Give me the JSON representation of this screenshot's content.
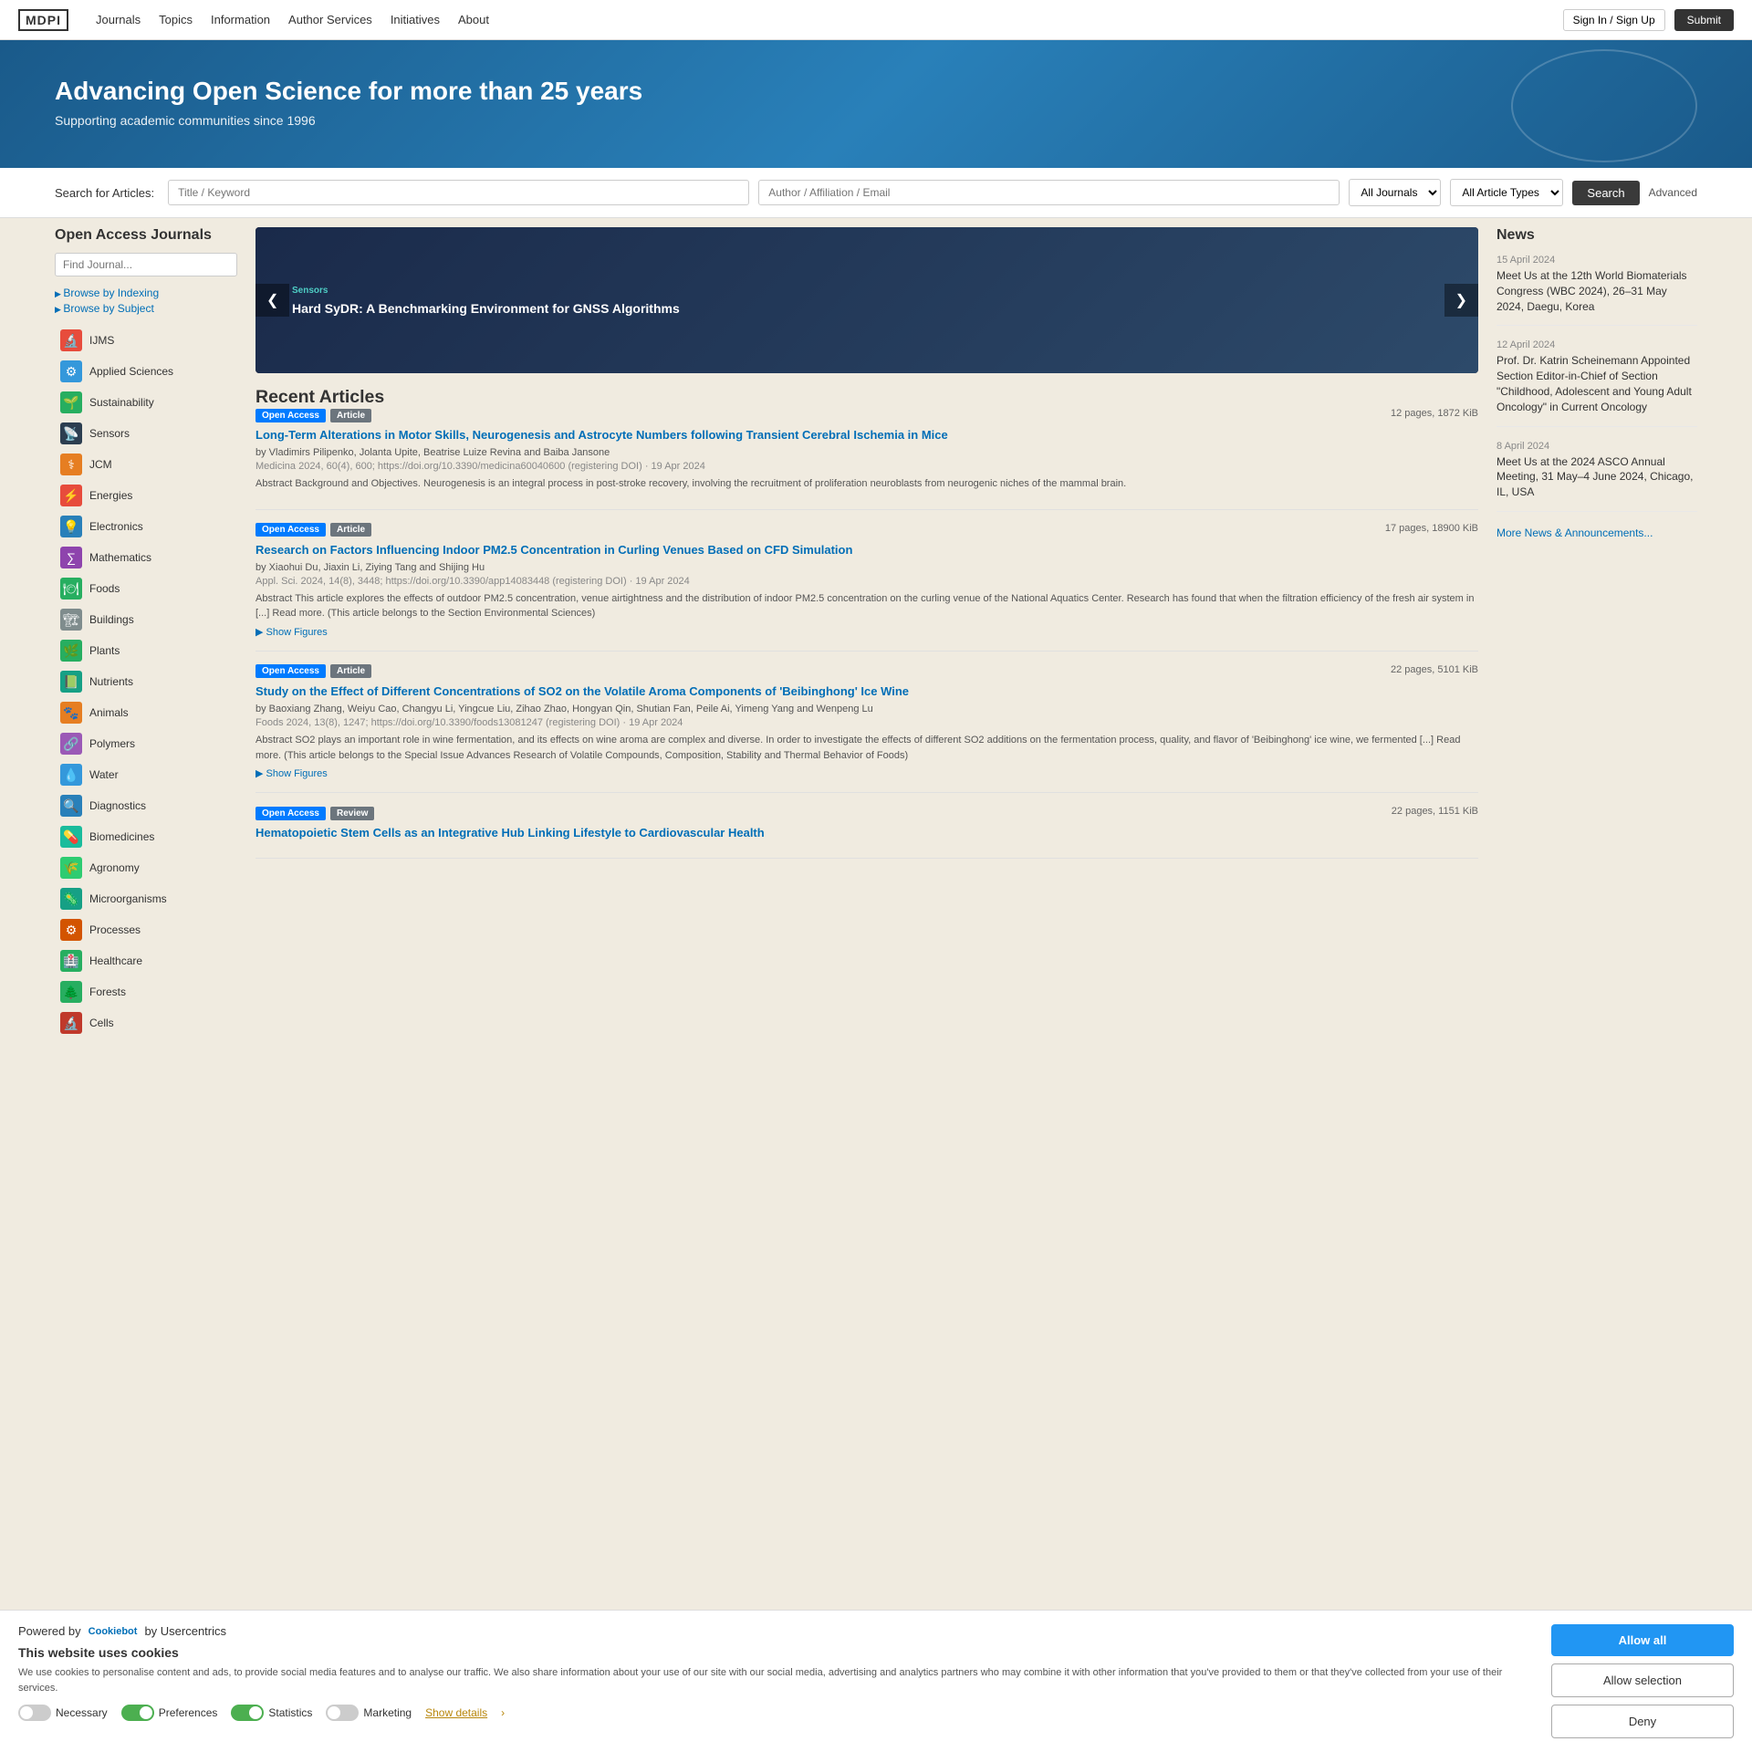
{
  "nav": {
    "logo": "MDPI",
    "links": [
      "Journals",
      "Topics",
      "Information",
      "Author Services",
      "Initiatives",
      "About"
    ],
    "signin": "Sign In / Sign Up",
    "submit": "Submit"
  },
  "hero": {
    "title": "Advancing Open Science for more than 25 years",
    "subtitle": "Supporting academic communities since 1996"
  },
  "search": {
    "label": "Search for Articles:",
    "title_placeholder": "Title / Keyword",
    "author_placeholder": "Author / Affiliation / Email",
    "journals_default": "All Journals",
    "types_default": "All Article Types",
    "search_btn": "Search",
    "advanced_btn": "Advanced"
  },
  "sidebar": {
    "title": "Open Access Journals",
    "find_journal_placeholder": "Find Journal...",
    "browse_by_indexing": "Browse by Indexing",
    "browse_by_subject": "Browse by Subject",
    "subjects": [
      {
        "label": "IJMS",
        "color": "#e74c3c",
        "icon": "🔬"
      },
      {
        "label": "Applied Sciences",
        "color": "#3498db",
        "icon": "⚙"
      },
      {
        "label": "Sustainability",
        "color": "#27ae60",
        "icon": "🌱"
      },
      {
        "label": "Sensors",
        "color": "#2c3e50",
        "icon": "📡"
      },
      {
        "label": "JCM",
        "color": "#e67e22",
        "icon": "⚕"
      },
      {
        "label": "Energies",
        "color": "#e74c3c",
        "icon": "⚡"
      },
      {
        "label": "Electronics",
        "color": "#2980b9",
        "icon": "💡"
      },
      {
        "label": "Mathematics",
        "color": "#8e44ad",
        "icon": "∑"
      },
      {
        "label": "Foods",
        "color": "#27ae60",
        "icon": "🍽"
      },
      {
        "label": "Buildings",
        "color": "#7f8c8d",
        "icon": "🏗"
      },
      {
        "label": "Plants",
        "color": "#27ae60",
        "icon": "🌿"
      },
      {
        "label": "Nutrients",
        "color": "#16a085",
        "icon": "📗"
      },
      {
        "label": "Animals",
        "color": "#e67e22",
        "icon": "🐾"
      },
      {
        "label": "Polymers",
        "color": "#9b59b6",
        "icon": "🔗"
      },
      {
        "label": "Water",
        "color": "#3498db",
        "icon": "💧"
      },
      {
        "label": "Diagnostics",
        "color": "#2980b9",
        "icon": "🔍"
      },
      {
        "label": "Biomedicines",
        "color": "#1abc9c",
        "icon": "💊"
      },
      {
        "label": "Agronomy",
        "color": "#2ecc71",
        "icon": "🌾"
      },
      {
        "label": "Microorganisms",
        "color": "#16a085",
        "icon": "🦠"
      },
      {
        "label": "Processes",
        "color": "#d35400",
        "icon": "⚙"
      },
      {
        "label": "Healthcare",
        "color": "#27ae60",
        "icon": "🏥"
      },
      {
        "label": "Forests",
        "color": "#27ae60",
        "icon": "🌲"
      },
      {
        "label": "Cells",
        "color": "#c0392b",
        "icon": "🔬"
      }
    ]
  },
  "carousel": {
    "journal": "Sensors",
    "title": "Hard SyDR: A Benchmarking Environment for GNSS Algorithms",
    "left_arrow": "❮",
    "right_arrow": "❯"
  },
  "recent_articles": {
    "heading": "Recent Articles",
    "articles": [
      {
        "badge_oa": "Open Access",
        "badge_type": "Article",
        "pages": "12 pages, 1872 KiB",
        "title": "Long-Term Alterations in Motor Skills, Neurogenesis and Astrocyte Numbers following Transient Cerebral Ischemia in Mice",
        "authors": "by Vladimirs Pilipenko, Jolanta Upite, Beatrise Luize Revina and Baiba Jansone",
        "journal": "Medicina 2024, 60(4), 600; https://doi.org/10.3390/medicina60040600 (registering DOI) · 19 Apr 2024",
        "abstract": "Abstract Background and Objectives. Neurogenesis is an integral process in post-stroke recovery, involving the recruitment of proliferation neuroblasts from neurogenic niches of the mammal brain.",
        "show_figures": false
      },
      {
        "badge_oa": "Open Access",
        "badge_type": "Article",
        "pages": "17 pages, 18900 KiB",
        "title": "Research on Factors Influencing Indoor PM2.5 Concentration in Curling Venues Based on CFD Simulation",
        "authors": "by Xiaohui Du, Jiaxin Li, Ziying Tang and Shijing Hu",
        "journal": "Appl. Sci. 2024, 14(8), 3448; https://doi.org/10.3390/app14083448 (registering DOI) · 19 Apr 2024",
        "abstract": "Abstract This article explores the effects of outdoor PM2.5 concentration, venue airtightness and the distribution of indoor PM2.5 concentration on the curling venue of the National Aquatics Center. Research has found that when the filtration efficiency of the fresh air system in [...] Read more. (This article belongs to the Section Environmental Sciences)",
        "show_figures": true
      },
      {
        "badge_oa": "Open Access",
        "badge_type": "Article",
        "pages": "22 pages, 5101 KiB",
        "title": "Study on the Effect of Different Concentrations of SO2 on the Volatile Aroma Components of 'Beibinghong' Ice Wine",
        "authors": "by Baoxiang Zhang, Weiyu Cao, Changyu Li, Yingcue Liu, Zihao Zhao, Hongyan Qin, Shutian Fan, Peile Ai, Yimeng Yang and Wenpeng Lu",
        "journal": "Foods 2024, 13(8), 1247; https://doi.org/10.3390/foods13081247 (registering DOI) · 19 Apr 2024",
        "abstract": "Abstract SO2 plays an important role in wine fermentation, and its effects on wine aroma are complex and diverse. In order to investigate the effects of different SO2 additions on the fermentation process, quality, and flavor of 'Beibinghong' ice wine, we fermented [...] Read more. (This article belongs to the Special Issue Advances Research of Volatile Compounds, Composition, Stability and Thermal Behavior of Foods)",
        "show_figures": true
      },
      {
        "badge_oa": "Open Access",
        "badge_type": "Review",
        "pages": "22 pages, 1151 KiB",
        "title": "Hematopoietic Stem Cells as an Integrative Hub Linking Lifestyle to Cardiovascular Health",
        "authors": "",
        "journal": "",
        "abstract": "",
        "show_figures": false
      }
    ]
  },
  "news": {
    "heading": "News",
    "items": [
      {
        "date": "15 April 2024",
        "text": "Meet Us at the 12th World Biomaterials Congress (WBC 2024), 26–31 May 2024, Daegu, Korea"
      },
      {
        "date": "12 April 2024",
        "text": "Prof. Dr. Katrin Scheinemann Appointed Section Editor-in-Chief of Section \"Childhood, Adolescent and Young Adult Oncology\" in Current Oncology"
      },
      {
        "date": "8 April 2024",
        "text": "Meet Us at the 2024 ASCO Annual Meeting, 31 May–4 June 2024, Chicago, IL, USA"
      }
    ],
    "more_link": "More News & Announcements..."
  },
  "cookie": {
    "powered_by": "Powered by",
    "cookiebot": "Cookiebot",
    "by_label": "by Usercentrics",
    "title": "This website uses cookies",
    "text": "We use cookies to personalise content and ads, to provide social media features and to analyse our traffic. We also share information about your use of our site with our social media, advertising and analytics partners who may combine it with other information that you've provided to them or that they've collected from your use of their services.",
    "necessary": "Necessary",
    "preferences": "Preferences",
    "statistics": "Statistics",
    "marketing": "Marketing",
    "show_details": "Show details",
    "allow_all": "Allow all",
    "allow_selection": "Allow selection",
    "deny": "Deny",
    "necessary_state": "off",
    "preferences_state": "on",
    "statistics_state": "on",
    "marketing_state": "off"
  }
}
